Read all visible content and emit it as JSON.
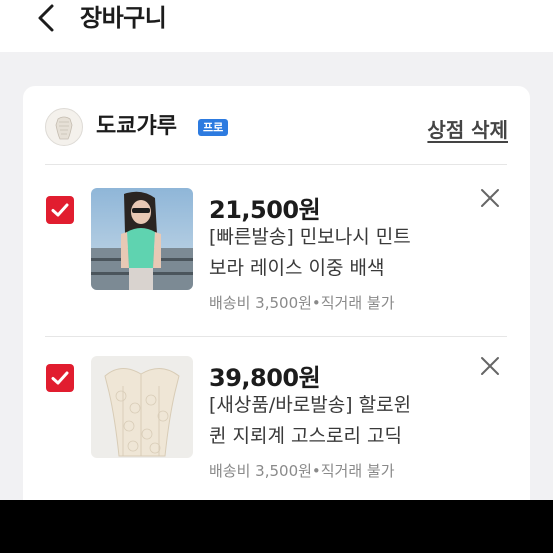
{
  "header": {
    "title": "장바구니",
    "back_icon": "chevron-left-icon"
  },
  "shop": {
    "name": "도쿄갸루",
    "badge": "프로",
    "delete_label": "상점 삭제",
    "badge_color": "#2d7be0"
  },
  "items": [
    {
      "checked": true,
      "price": "21,500원",
      "title_line1": "[빠른발송] 민보나시 민트",
      "title_line2": "보라 레이스 이중 배색",
      "meta": "배송비 3,500원•직거래 불가"
    },
    {
      "checked": true,
      "price": "39,800원",
      "title_line1": "[새상품/바로발송] 할로윈",
      "title_line2": "퀸 지뢰계 고스로리 고딕",
      "meta": "배송비 3,500원•직거래 불가"
    }
  ],
  "colors": {
    "accent": "#e11d2f",
    "background": "#f1f1f3"
  }
}
